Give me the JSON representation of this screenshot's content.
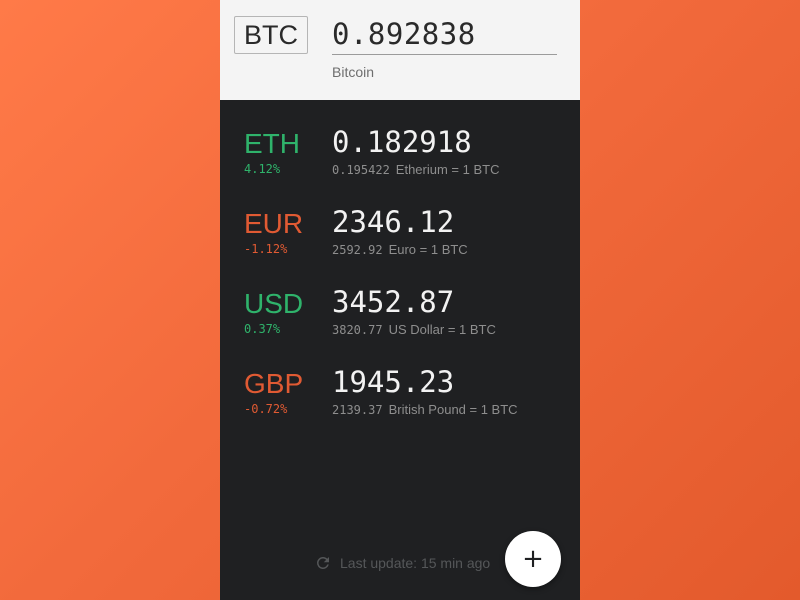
{
  "base": {
    "code": "BTC",
    "amount": "0.892838",
    "name": "Bitcoin"
  },
  "rates": [
    {
      "code": "ETH",
      "change": "4.12%",
      "trend": "up",
      "value": "0.182918",
      "rate": "0.195422",
      "label": "Etherium = 1 BTC"
    },
    {
      "code": "EUR",
      "change": "-1.12%",
      "trend": "down",
      "value": "2346.12",
      "rate": "2592.92",
      "label": "Euro = 1 BTC"
    },
    {
      "code": "USD",
      "change": "0.37%",
      "trend": "up",
      "value": "3452.87",
      "rate": "3820.77",
      "label": "US Dollar = 1 BTC"
    },
    {
      "code": "GBP",
      "change": "-0.72%",
      "trend": "down",
      "value": "1945.23",
      "rate": "2139.37",
      "label": "British Pound = 1 BTC"
    }
  ],
  "footer": {
    "status": "Last update: 15 min ago",
    "refresh_icon": "refresh-icon",
    "add_icon": "+"
  },
  "colors": {
    "up": "#2fb36b",
    "down": "#e05a33",
    "background_accent": "#f26a3c",
    "panel": "#1f2022",
    "header": "#f4f4f4"
  }
}
